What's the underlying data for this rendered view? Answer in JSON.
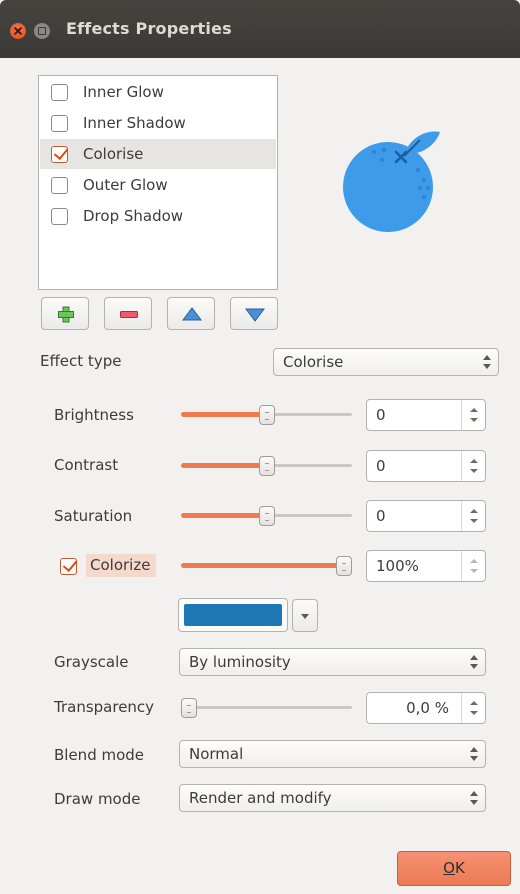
{
  "window": {
    "title": "Effects Properties",
    "controls": [
      "close-icon",
      "minimize-icon"
    ]
  },
  "effects": [
    {
      "label": "Inner Glow",
      "checked": false,
      "selected": false
    },
    {
      "label": "Inner Shadow",
      "checked": false,
      "selected": false
    },
    {
      "label": "Colorise",
      "checked": true,
      "selected": true
    },
    {
      "label": "Outer Glow",
      "checked": false,
      "selected": false
    },
    {
      "label": "Drop Shadow",
      "checked": false,
      "selected": false
    }
  ],
  "toolbar": {
    "icons": [
      "add-icon",
      "remove-icon",
      "move-up-icon",
      "move-down-icon"
    ]
  },
  "effect_type": {
    "label": "Effect type",
    "value": "Colorise"
  },
  "brightness": {
    "label": "Brightness",
    "value": "0",
    "level": 0.5
  },
  "contrast": {
    "label": "Contrast",
    "value": "0",
    "level": 0.5
  },
  "saturation": {
    "label": "Saturation",
    "value": "0",
    "level": 0.5
  },
  "colorize": {
    "label": "Colorize",
    "checked": true,
    "value": "100%",
    "level": 1.0,
    "color": "#1f78b4"
  },
  "grayscale": {
    "label": "Grayscale",
    "value": "By luminosity"
  },
  "transparency": {
    "label": "Transparency",
    "value": "0,0 %",
    "level": 0.0
  },
  "blend_mode": {
    "label": "Blend mode",
    "value": "Normal"
  },
  "draw_mode": {
    "label": "Draw mode",
    "value": "Render and modify"
  },
  "ok": {
    "prefix": "",
    "accel": "O",
    "rest": "K"
  },
  "colors": {
    "accent": "#ef7a4d",
    "preview_fill": "#3d9be9",
    "leaf": "#3d9be9"
  }
}
